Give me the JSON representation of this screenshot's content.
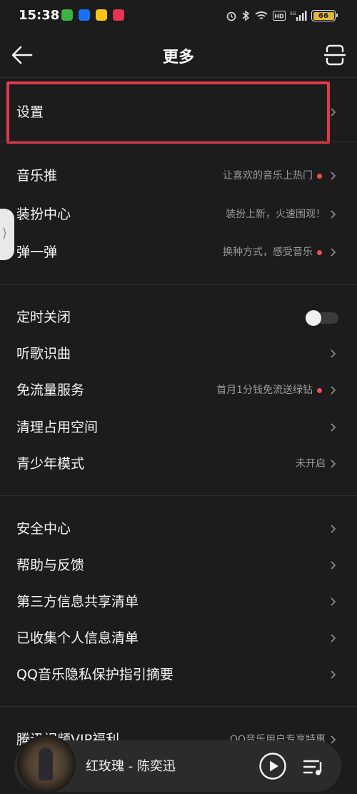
{
  "status_bar": {
    "time": "15:38",
    "apps": [
      {
        "icon": "app-icon-green",
        "color": "#3cb043"
      },
      {
        "icon": "zhihu-icon",
        "color": "#1772f6"
      },
      {
        "icon": "app-icon-yellow",
        "color": "#f5c518"
      },
      {
        "icon": "video-app-icon",
        "color": "#e8344e"
      }
    ],
    "battery": "66"
  },
  "header": {
    "title": "更多",
    "back_icon": "back-arrow-icon",
    "scan_icon": "scan-icon"
  },
  "rows": {
    "settings": {
      "label": "设置"
    },
    "music_push": {
      "label": "音乐推",
      "sub": "让喜欢的音乐上热门"
    },
    "dressup": {
      "label": "装扮中心",
      "sub": "装扮上新，火速围观！"
    },
    "tanyitan": {
      "label": "弹一弹",
      "sub": "换种方式，感受音乐"
    },
    "timer": {
      "label": "定时关闭",
      "toggle": false
    },
    "recognize": {
      "label": "听歌识曲"
    },
    "free_data": {
      "label": "免流量服务",
      "sub": "首月1分钱免流送绿钻"
    },
    "clean": {
      "label": "清理占用空间"
    },
    "teen": {
      "label": "青少年模式",
      "sub": "未开启"
    },
    "security": {
      "label": "安全中心"
    },
    "help": {
      "label": "帮助与反馈"
    },
    "third_party": {
      "label": "第三方信息共享清单"
    },
    "collected": {
      "label": "已收集个人信息清单"
    },
    "privacy": {
      "label": "QQ音乐隐私保护指引摘要"
    },
    "tencent_video": {
      "label": "腾讯视频VIP福利",
      "sub": "QQ音乐用户专享特惠"
    }
  },
  "player": {
    "title": "红玫瑰 - 陈奕迅"
  },
  "colors": {
    "background": "#1c1c1c",
    "highlight": "#e23a4a",
    "dot": "#f04e4e",
    "battery": "#e0b53d"
  }
}
